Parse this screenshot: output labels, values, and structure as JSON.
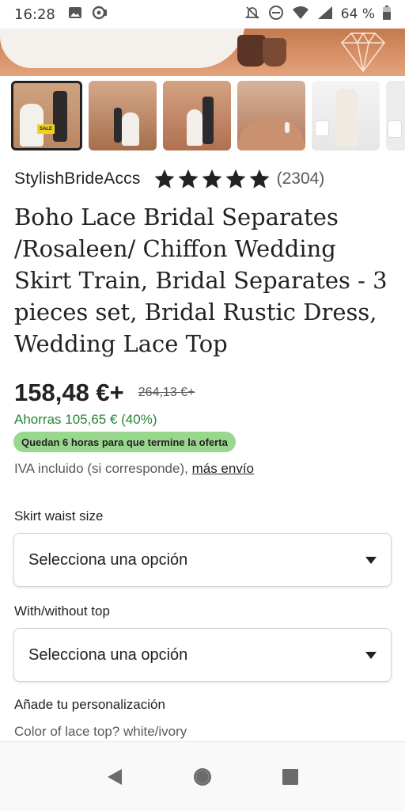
{
  "status_bar": {
    "time": "16:28",
    "battery_percent": "64 %",
    "icons": [
      "gallery-icon",
      "whatsapp-icon",
      "mute-icon",
      "dnd-icon",
      "wifi-icon",
      "signal-icon",
      "battery-icon"
    ]
  },
  "hero": {
    "icon": "diamond-watermark-icon"
  },
  "thumbnails": [
    {
      "name": "thumbnail-1",
      "selected": true,
      "badge": "SALE"
    },
    {
      "name": "thumbnail-2",
      "selected": false
    },
    {
      "name": "thumbnail-3",
      "selected": false
    },
    {
      "name": "thumbnail-4",
      "selected": false
    },
    {
      "name": "thumbnail-5",
      "selected": false
    },
    {
      "name": "thumbnail-6",
      "selected": false
    }
  ],
  "shop": {
    "name": "StylishBrideAccs",
    "rating": 5,
    "reviews": "(2304)"
  },
  "product": {
    "title": "Boho Lace Bridal Separates /Rosaleen/ Chiffon Wedding Skirt Train, Bridal Separates - 3 pieces set, Bridal Rustic Dress, Wedding Lace Top",
    "price": "158,48 €+",
    "old_price": "264,13 €+",
    "savings": "Ahorras 105,65 € (40%)",
    "offer_badge": "Quedan 6 horas para que termine la oferta",
    "tax_text": "IVA incluido (si corresponde), ",
    "shipping_link": "más envío"
  },
  "options": {
    "skirt_label": "Skirt waist size",
    "skirt_value": "Selecciona una opción",
    "top_label": "With/without top",
    "top_value": "Selecciona una opción",
    "personalization_label": "Añade tu personalización",
    "personalization_question": "Color of lace top? white/ivory"
  },
  "colors": {
    "savings_green": "#258635",
    "badge_green": "#9ad78e",
    "text": "#222222"
  },
  "nav": {
    "back": "back-icon",
    "home": "home-icon",
    "recents": "recents-icon"
  }
}
